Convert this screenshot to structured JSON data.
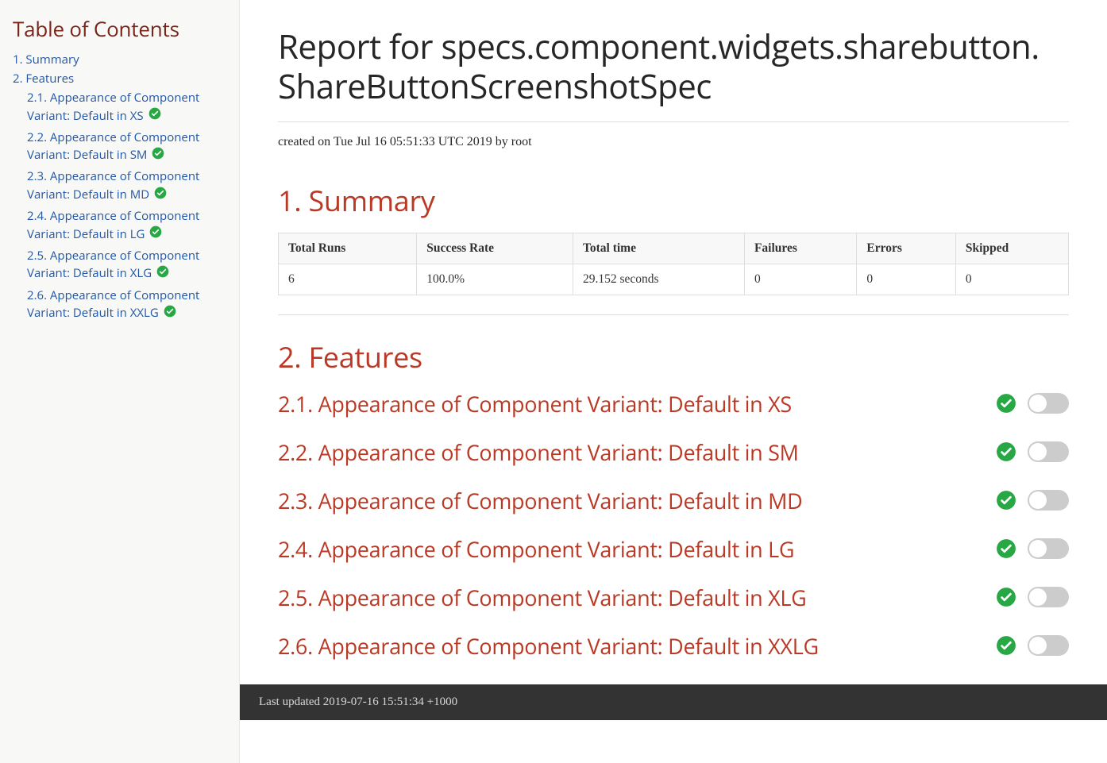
{
  "toc": {
    "title": "Table of Contents",
    "items": [
      {
        "label": "1. Summary"
      },
      {
        "label": "2. Features",
        "children": [
          {
            "label": "2.1. Appearance of Component Variant: Default in XS"
          },
          {
            "label": "2.2. Appearance of Component Variant: Default in SM"
          },
          {
            "label": "2.3. Appearance of Component Variant: Default in MD"
          },
          {
            "label": "2.4. Appearance of Component Variant: Default in LG"
          },
          {
            "label": "2.5. Appearance of Component Variant: Default in XLG"
          },
          {
            "label": "2.6. Appearance of Component Variant: Default in XXLG"
          }
        ]
      }
    ]
  },
  "header": {
    "title": "Report for specs.component.widgets.sharebutton. ShareButtonScreenshotSpec",
    "meta": "created on Tue Jul 16 05:51:33 UTC 2019 by root"
  },
  "summary": {
    "heading": "1. Summary",
    "columns": [
      "Total Runs",
      "Success Rate",
      "Total time",
      "Failures",
      "Errors",
      "Skipped"
    ],
    "row": [
      "6",
      "100.0%",
      "29.152 seconds",
      "0",
      "0",
      "0"
    ]
  },
  "features": {
    "heading": "2. Features",
    "items": [
      {
        "title": "2.1. Appearance of Component Variant: Default in XS"
      },
      {
        "title": "2.2. Appearance of Component Variant: Default in SM"
      },
      {
        "title": "2.3. Appearance of Component Variant: Default in MD"
      },
      {
        "title": "2.4. Appearance of Component Variant: Default in LG"
      },
      {
        "title": "2.5. Appearance of Component Variant: Default in XLG"
      },
      {
        "title": "2.6. Appearance of Component Variant: Default in XXLG"
      }
    ]
  },
  "footer": {
    "text": "Last updated 2019-07-16 15:51:34 +1000"
  },
  "colors": {
    "link": "#2156a5",
    "heading": "#ba3925",
    "success": "#28a745"
  }
}
